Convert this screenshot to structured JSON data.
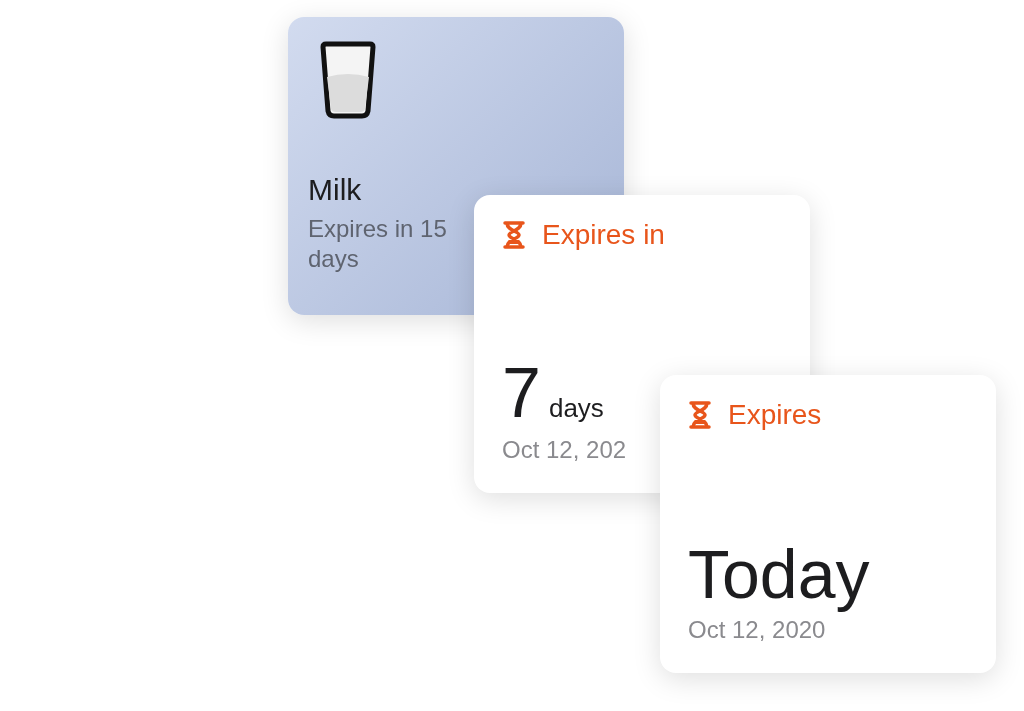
{
  "cards": [
    {
      "kind": "item",
      "title": "Milk",
      "subtitle": "Expires in 15 days"
    },
    {
      "kind": "countdown",
      "label": "Expires in",
      "value": "7",
      "unit": "days",
      "date": "Oct 12, 202"
    },
    {
      "kind": "date",
      "label": "Expires",
      "value": "Today",
      "date": "Oct 12, 2020"
    }
  ]
}
